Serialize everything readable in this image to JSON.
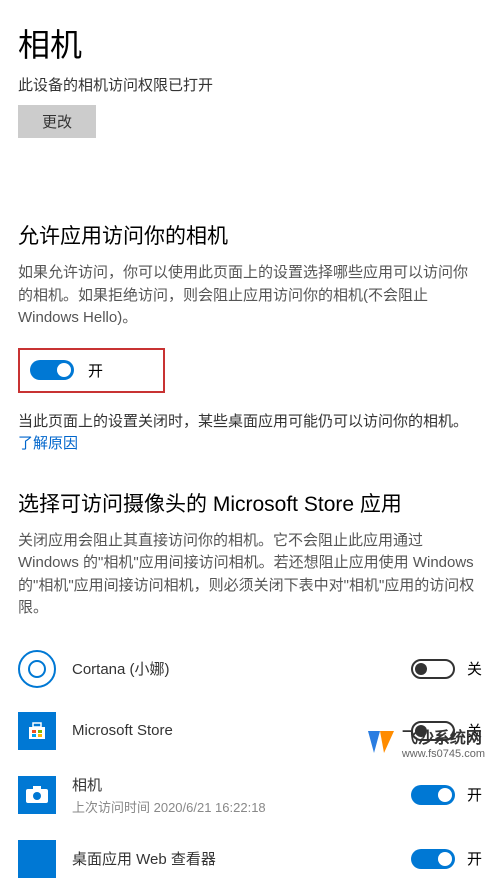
{
  "header": {
    "title": "相机",
    "status": "此设备的相机访问权限已打开",
    "change_btn": "更改"
  },
  "allow_apps": {
    "heading": "允许应用访问你的相机",
    "description": "如果允许访问，你可以使用此页面上的设置选择哪些应用可以访问你的相机。如果拒绝访问，则会阻止应用访问你的相机(不会阻止 Windows Hello)。",
    "toggle_state": "开",
    "note_text": "当此页面上的设置关闭时，某些桌面应用可能仍可以访问你的相机。",
    "link_text": "了解原因"
  },
  "choose_apps": {
    "heading": "选择可访问摄像头的 Microsoft Store 应用",
    "description": "关闭应用会阻止其直接访问你的相机。它不会阻止此应用通过 Windows 的\"相机\"应用间接访问相机。若还想阻止应用使用 Windows 的\"相机\"应用间接访问相机，则必须关闭下表中对\"相机\"应用的访问权限。"
  },
  "apps": [
    {
      "name": "Cortana (小娜)",
      "subtext": "",
      "toggle_on": false,
      "toggle_label": "关"
    },
    {
      "name": "Microsoft Store",
      "subtext": "",
      "toggle_on": false,
      "toggle_label": "关"
    },
    {
      "name": "相机",
      "subtext": "上次访问时间 2020/6/21 16:22:18",
      "toggle_on": true,
      "toggle_label": "开"
    },
    {
      "name": "桌面应用 Web 查看器",
      "subtext": "",
      "toggle_on": true,
      "toggle_label": "开"
    }
  ],
  "watermark": {
    "brand": "飞沙系统网",
    "url": "www.fs0745.com"
  }
}
